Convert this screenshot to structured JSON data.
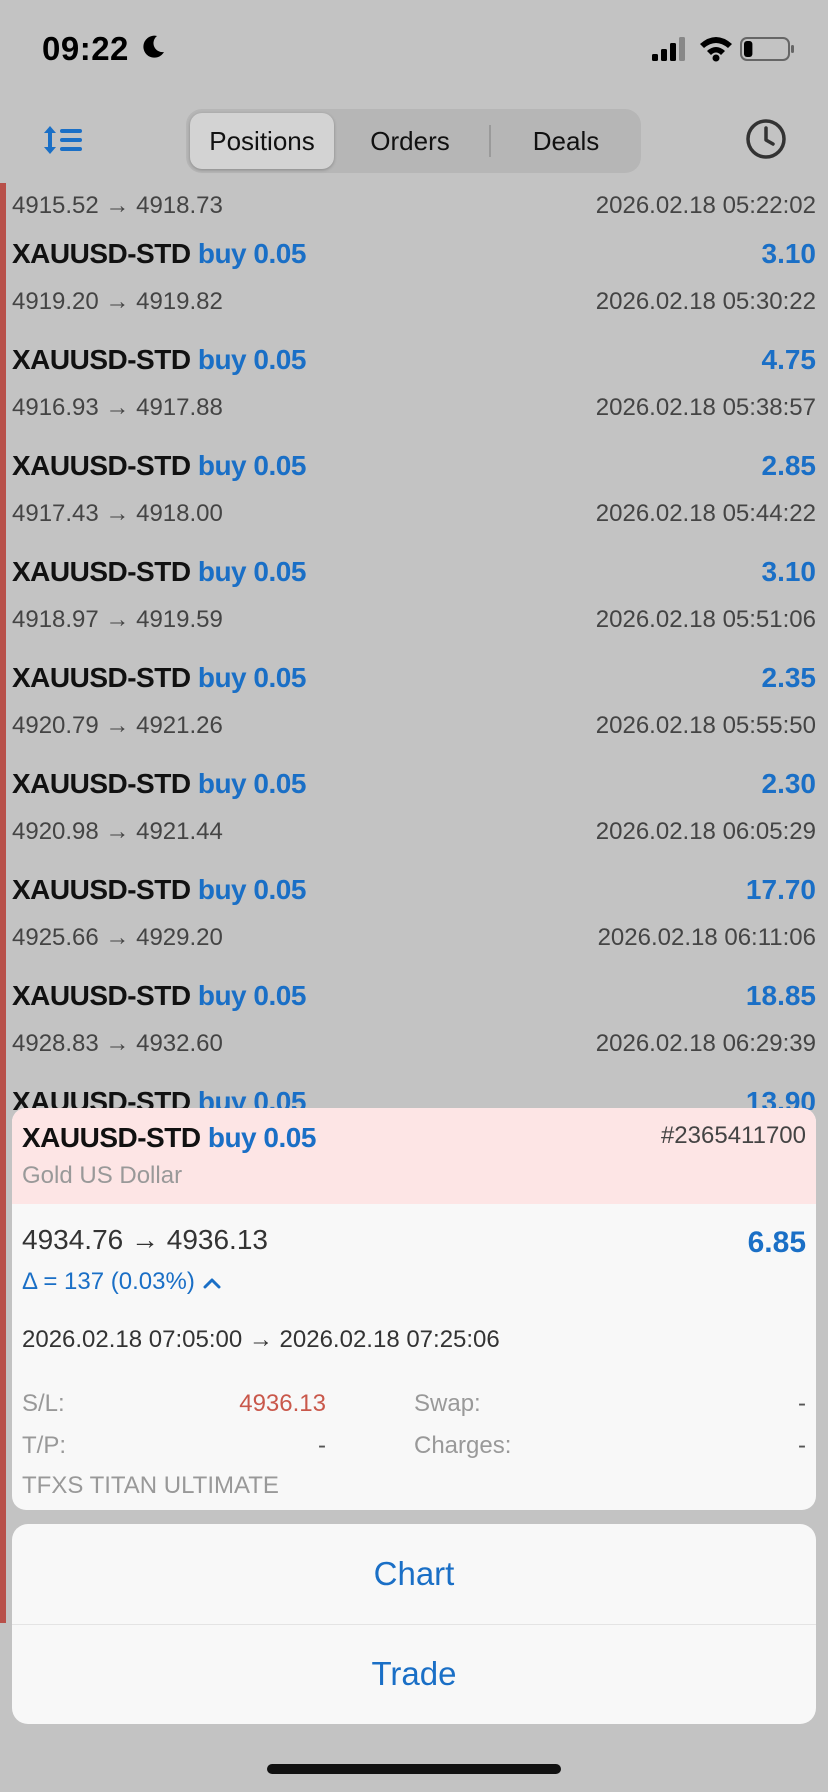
{
  "status_bar": {
    "time": "09:22",
    "battery_level": 0.2
  },
  "toolbar": {
    "tabs": [
      {
        "label": "Positions",
        "active": true
      },
      {
        "label": "Orders",
        "active": false
      },
      {
        "label": "Deals",
        "active": false
      }
    ],
    "icons": [
      "sort-icon",
      "clock-icon"
    ]
  },
  "list": {
    "first_partial": {
      "prices": "4915.52 → 4918.73",
      "datetime": "2026.02.18 05:22:02"
    },
    "rows": [
      {
        "symbol": "XAUUSD-STD",
        "side": "buy 0.05",
        "profit": "3.10",
        "prices": "4919.20 → 4919.82",
        "datetime": "2026.02.18 05:30:22"
      },
      {
        "symbol": "XAUUSD-STD",
        "side": "buy 0.05",
        "profit": "4.75",
        "prices": "4916.93 → 4917.88",
        "datetime": "2026.02.18 05:38:57"
      },
      {
        "symbol": "XAUUSD-STD",
        "side": "buy 0.05",
        "profit": "2.85",
        "prices": "4917.43 → 4918.00",
        "datetime": "2026.02.18 05:44:22"
      },
      {
        "symbol": "XAUUSD-STD",
        "side": "buy 0.05",
        "profit": "3.10",
        "prices": "4918.97 → 4919.59",
        "datetime": "2026.02.18 05:51:06"
      },
      {
        "symbol": "XAUUSD-STD",
        "side": "buy 0.05",
        "profit": "2.35",
        "prices": "4920.79 → 4921.26",
        "datetime": "2026.02.18 05:55:50"
      },
      {
        "symbol": "XAUUSD-STD",
        "side": "buy 0.05",
        "profit": "2.30",
        "prices": "4920.98 → 4921.44",
        "datetime": "2026.02.18 06:05:29"
      },
      {
        "symbol": "XAUUSD-STD",
        "side": "buy 0.05",
        "profit": "17.70",
        "prices": "4925.66 → 4929.20",
        "datetime": "2026.02.18 06:11:06"
      },
      {
        "symbol": "XAUUSD-STD",
        "side": "buy 0.05",
        "profit": "18.85",
        "prices": "4928.83 → 4932.60",
        "datetime": "2026.02.18 06:29:39"
      },
      {
        "symbol": "XAUUSD-STD",
        "side": "buy 0.05",
        "profit": "13.90",
        "prices": "",
        "datetime": ""
      }
    ]
  },
  "detail_card": {
    "symbol": "XAUUSD-STD",
    "side": "buy 0.05",
    "ticket": "#2365411700",
    "description": "Gold US Dollar",
    "prices": "4934.76 → 4936.13",
    "profit": "6.85",
    "delta": "Δ = 137 (0.03%)",
    "times": "2026.02.18 07:05:00 → 2026.02.18 07:25:06",
    "sl_label": "S/L:",
    "sl_value": "4936.13",
    "tp_label": "T/P:",
    "tp_value": "-",
    "swap_label": "Swap:",
    "swap_value": "-",
    "charges_label": "Charges:",
    "charges_value": "-",
    "company": "TFXS TITAN ULTIMATE"
  },
  "actions": {
    "chart_label": "Chart",
    "trade_label": "Trade"
  },
  "colors": {
    "accent": "#1a6fc6",
    "loss": "#c9584b",
    "card_header": "#fde5e5",
    "left_accent": "#b8504a"
  }
}
